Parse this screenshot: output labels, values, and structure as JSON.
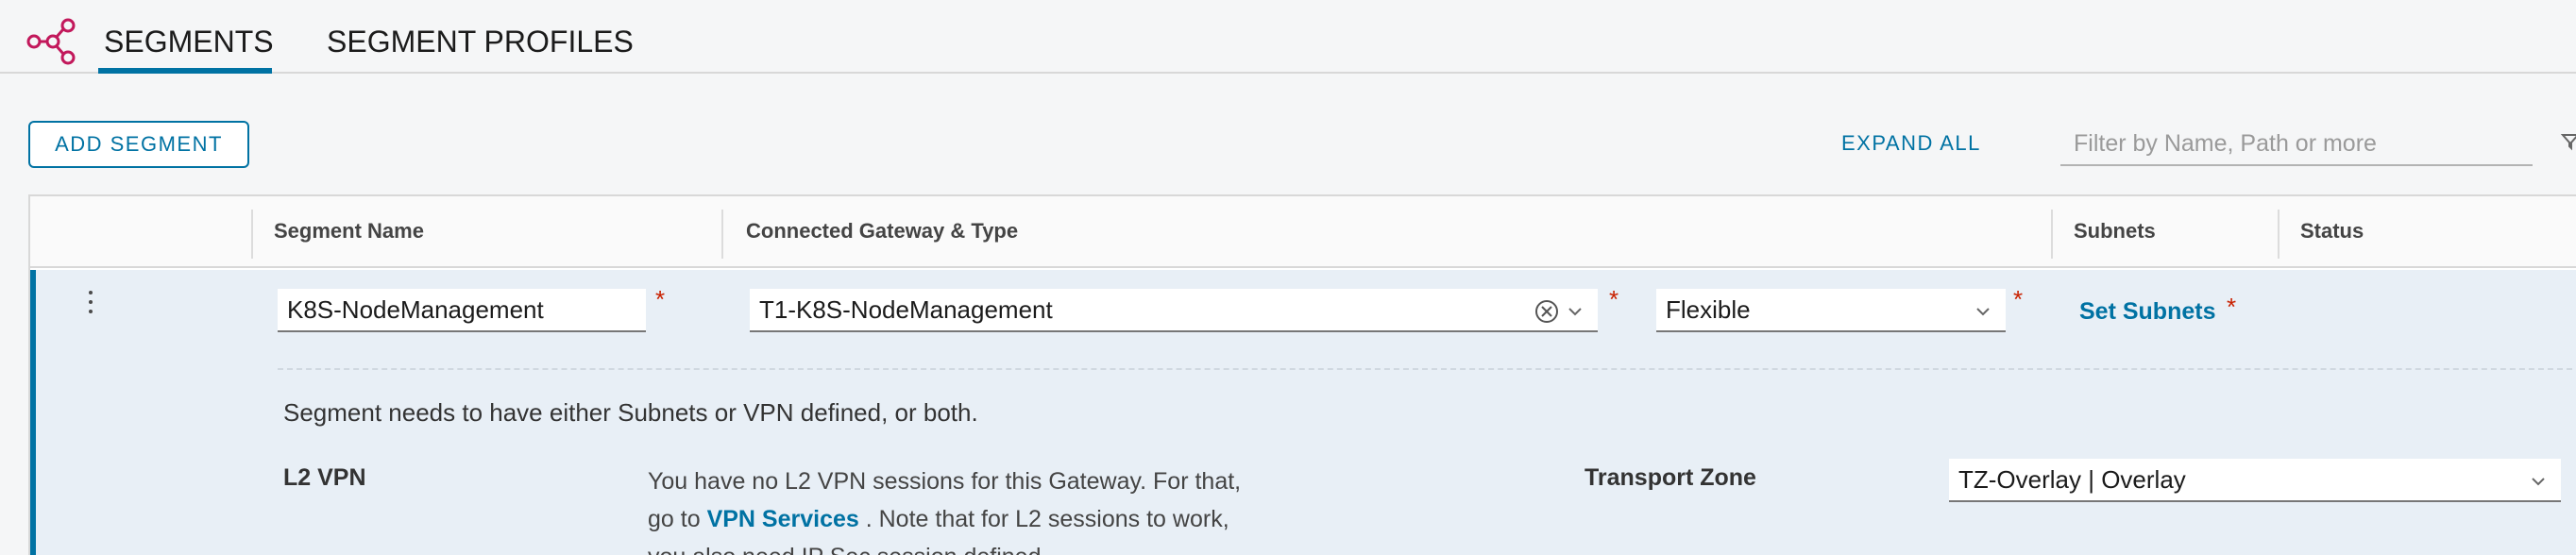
{
  "tabs": {
    "segments": "SEGMENTS",
    "segment_profiles": "SEGMENT PROFILES"
  },
  "toolbar": {
    "add_segment": "ADD SEGMENT",
    "expand_all": "EXPAND ALL",
    "filter_placeholder": "Filter by Name, Path or more"
  },
  "table": {
    "headers": {
      "segment_name": "Segment Name",
      "connected_gateway": "Connected Gateway & Type",
      "subnets": "Subnets",
      "status": "Status"
    },
    "row": {
      "segment_name": "K8S-NodeManagement",
      "gateway": "T1-K8S-NodeManagement",
      "gateway_type": "Flexible",
      "set_subnets": "Set Subnets",
      "required_marker": "*",
      "note": "Segment needs to have either Subnets or VPN defined, or both.",
      "l2vpn_label": "L2 VPN",
      "l2vpn_text_1": "You have no L2 VPN sessions for this Gateway. For that,",
      "l2vpn_text_2": "go to",
      "l2vpn_link": "VPN Services",
      "l2vpn_text_3": ". Note that for L2 sessions to work,",
      "l2vpn_text_4": "you also need IP Sec session defined.",
      "transport_zone_label": "Transport Zone",
      "transport_zone_value": "TZ-Overlay | Overlay"
    }
  },
  "colors": {
    "accent": "#0072a3",
    "required": "#c92100",
    "icon": "#c2185b"
  }
}
